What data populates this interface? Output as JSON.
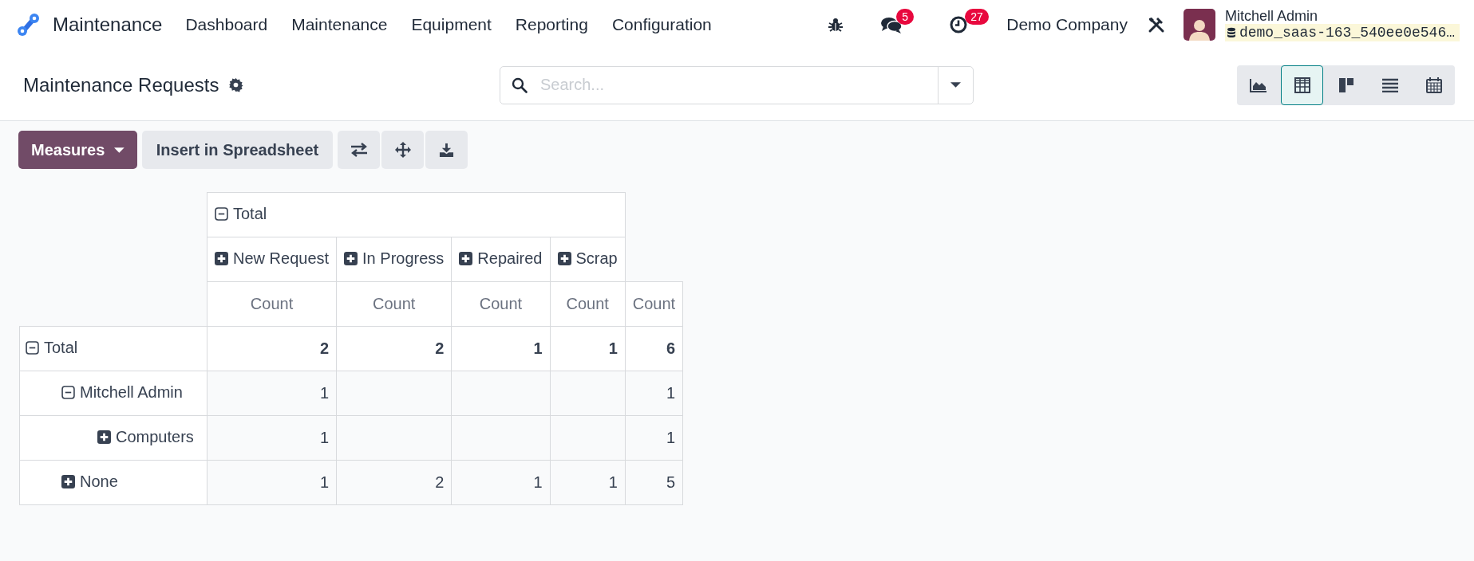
{
  "app": {
    "name": "Maintenance"
  },
  "menu": [
    "Dashboard",
    "Maintenance",
    "Equipment",
    "Reporting",
    "Configuration"
  ],
  "systray": {
    "messages_badge": "5",
    "activities_badge": "27",
    "company": "Demo Company",
    "user": {
      "name": "Mitchell Admin",
      "database": "demo_saas-163_540ee0e546…"
    }
  },
  "control_panel": {
    "title": "Maintenance Requests",
    "search": {
      "placeholder": "Search..."
    },
    "views": [
      {
        "kind": "graph",
        "selected": false
      },
      {
        "kind": "pivot",
        "selected": true
      },
      {
        "kind": "kanban",
        "selected": false
      },
      {
        "kind": "list",
        "selected": false
      },
      {
        "kind": "calendar",
        "selected": false
      }
    ]
  },
  "toolbar": {
    "measures": "Measures",
    "insert": "Insert in Spreadsheet",
    "actions": [
      {
        "kind": "flip"
      },
      {
        "kind": "expand"
      },
      {
        "kind": "download"
      }
    ]
  },
  "pivot": {
    "column_header": {
      "label": "Total",
      "expanded": true,
      "children": [
        {
          "label": "New Request",
          "expanded": false
        },
        {
          "label": "In Progress",
          "expanded": false
        },
        {
          "label": "Repaired",
          "expanded": false
        },
        {
          "label": "Scrap",
          "expanded": false
        }
      ]
    },
    "measure_headers": [
      "Count",
      "Count",
      "Count",
      "Count",
      "Count"
    ],
    "rows": [
      {
        "label": "Total",
        "expanded": true,
        "values": [
          {
            "value": "2"
          },
          {
            "value": "2"
          },
          {
            "value": "1"
          },
          {
            "value": "1"
          },
          {
            "value": "6"
          }
        ],
        "children": [
          {
            "label": "Mitchell Admin",
            "expanded": true,
            "values": [
              {
                "value": "1"
              },
              {
                "empty": true
              },
              {
                "empty": true
              },
              {
                "empty": true
              },
              {
                "value": "1"
              }
            ],
            "children": [
              {
                "label": "Computers",
                "expanded": false,
                "values": [
                  {
                    "value": "1"
                  },
                  {
                    "empty": true
                  },
                  {
                    "empty": true
                  },
                  {
                    "empty": true
                  },
                  {
                    "value": "1"
                  }
                ]
              }
            ]
          },
          {
            "label": "None",
            "expanded": false,
            "values": [
              {
                "value": "1"
              },
              {
                "value": "2"
              },
              {
                "value": "1"
              },
              {
                "value": "1"
              },
              {
                "value": "5"
              }
            ]
          }
        ]
      }
    ]
  }
}
